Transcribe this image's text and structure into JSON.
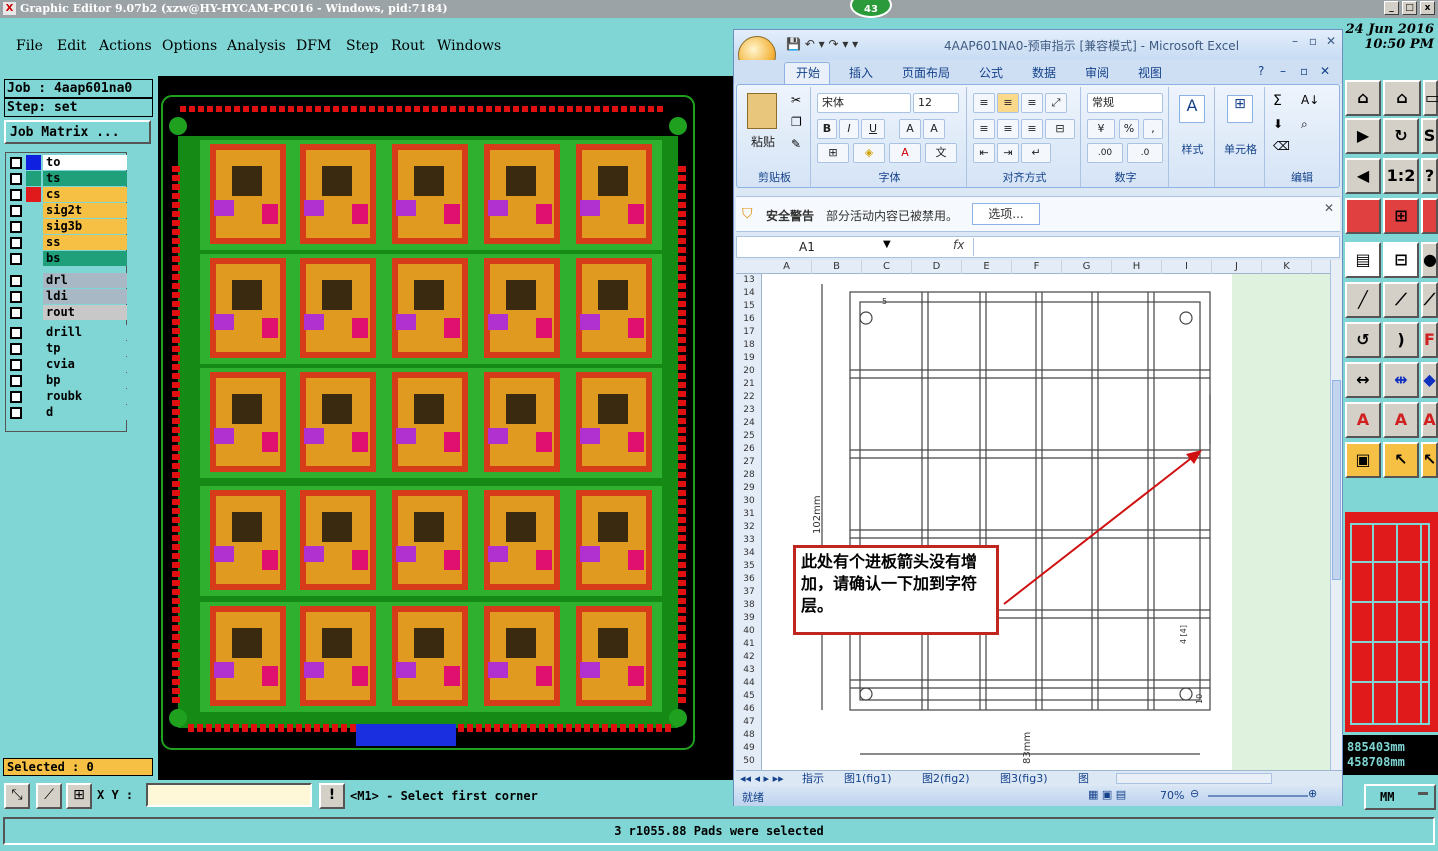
{
  "window": {
    "title": "Graphic Editor 9.07b2 (xzw@HY-HYCAM-PC016 - Windows, pid:7184)",
    "badge": "43",
    "min": "_",
    "max": "□",
    "close": "x"
  },
  "menu": {
    "items": [
      {
        "label": "File"
      },
      {
        "label": "Edit"
      },
      {
        "label": "Actions"
      },
      {
        "label": "Options"
      },
      {
        "label": "Analysis"
      },
      {
        "label": "DFM"
      },
      {
        "label": "Step"
      },
      {
        "label": "Rout"
      },
      {
        "label": "Windows"
      }
    ],
    "clock_date": "24 Jun 2016",
    "clock_time": "10:50 PM"
  },
  "left": {
    "job": "Job : 4aap601na0",
    "step": "Step: set",
    "job_matrix": "Job Matrix ...",
    "selected": "Selected : 0",
    "layers": [
      {
        "name": "to",
        "bg": "#ffffff",
        "swatch": "#1020e0"
      },
      {
        "name": "ts",
        "bg": "#1f9f7a",
        "swatch": "#1f9f7a"
      },
      {
        "name": "cs",
        "bg": "#f5c044",
        "swatch": "#e01a1a",
        "active": true
      },
      {
        "name": "sig2t",
        "bg": "#f5c044",
        "swatch": "#7fd6d4"
      },
      {
        "name": "sig3b",
        "bg": "#f5c044",
        "swatch": "#7fd6d4"
      },
      {
        "name": "ss",
        "bg": "#f5c044",
        "swatch": "#7fd6d4"
      },
      {
        "name": "bs",
        "bg": "#1f9f7a",
        "swatch": "#7fd6d4"
      },
      {
        "name": "drl",
        "bg": "#a8b8c4",
        "swatch": "#7fd6d4"
      },
      {
        "name": "ldi",
        "bg": "#a8b8c4",
        "swatch": "#7fd6d4"
      },
      {
        "name": "rout",
        "bg": "#c8c8c8",
        "swatch": "#7fd6d4"
      },
      {
        "name": "drill",
        "bg": "#7fd6d4",
        "swatch": "#7fd6d4"
      },
      {
        "name": "tp",
        "bg": "#7fd6d4",
        "swatch": "#7fd6d4"
      },
      {
        "name": "cvia",
        "bg": "#7fd6d4",
        "swatch": "#7fd6d4"
      },
      {
        "name": "bp",
        "bg": "#7fd6d4",
        "swatch": "#7fd6d4"
      },
      {
        "name": "roubk",
        "bg": "#7fd6d4",
        "swatch": "#7fd6d4"
      },
      {
        "name": "d",
        "bg": "#7fd6d4",
        "swatch": "#7fd6d4"
      }
    ]
  },
  "bottom": {
    "xy_label": "X Y :",
    "xy_value": "",
    "alert": "!",
    "prompt": "<M1> - Select first corner",
    "status": "3 r1055.88 Pads were selected",
    "unit": "MM"
  },
  "right": {
    "coord_x": "885403mm",
    "coord_y": "458708mm"
  },
  "excel": {
    "caption": "4AAP601NA0-预审指示  [兼容模式] - Microsoft Excel",
    "tabs": [
      "开始",
      "插入",
      "页面布局",
      "公式",
      "数据",
      "审阅",
      "视图"
    ],
    "groups": {
      "clipboard": "剪贴板",
      "font": "字体",
      "alignment": "对齐方式",
      "number": "数字",
      "styles": "样式",
      "cells": "单元格",
      "editing": "编辑"
    },
    "paste": "粘贴",
    "font_name": "宋体",
    "font_size": "12",
    "number_format": "常规",
    "security_title": "安全警告",
    "security_msg": "部分活动内容已被禁用。",
    "options_btn": "选项...",
    "name_box": "A1",
    "fx": "fx",
    "columns": [
      "A",
      "B",
      "C",
      "D",
      "E",
      "F",
      "G",
      "H",
      "I",
      "J",
      "K"
    ],
    "rows": [
      "13",
      "14",
      "15",
      "16",
      "17",
      "18",
      "19",
      "20",
      "21",
      "22",
      "23",
      "24",
      "25",
      "26",
      "27",
      "28",
      "29",
      "30",
      "31",
      "32",
      "33",
      "34",
      "35",
      "36",
      "37",
      "38",
      "39",
      "40",
      "41",
      "42",
      "43",
      "44",
      "45",
      "46",
      "47",
      "48",
      "49",
      "50"
    ],
    "sheet_tabs": [
      "指示",
      "图1(fig1)",
      "图2(fig2)",
      "图3(fig3)",
      "图"
    ],
    "status_ready": "就绪",
    "zoom": "70%",
    "drawing": {
      "dim_height": "102mm",
      "dim_width": "83mm",
      "dim_5": "5",
      "dim_4": "4 [4]",
      "dim_10": "10"
    },
    "callout": "此处有个进板箭头没有增加，请确认一下加到字符层。"
  }
}
